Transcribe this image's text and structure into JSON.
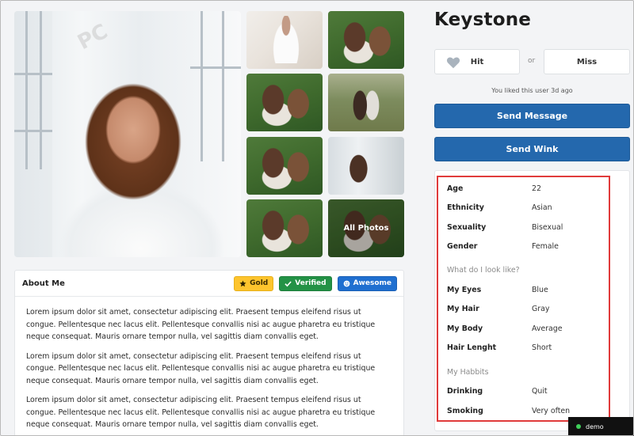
{
  "watermark": "PC",
  "gallery": {
    "all_photos_label": "All Photos"
  },
  "about": {
    "title": "About Me",
    "badges": {
      "gold": "Gold",
      "verified": "Verified",
      "awesome": "Awesome"
    },
    "paragraphs": [
      "Lorem ipsum dolor sit amet, consectetur adipiscing elit. Praesent tempus eleifend risus ut congue. Pellentesque nec lacus elit. Pellentesque convallis nisi ac augue pharetra eu tristique neque consequat. Mauris ornare tempor nulla, vel sagittis diam convallis eget.",
      "Lorem ipsum dolor sit amet, consectetur adipiscing elit. Praesent tempus eleifend risus ut congue. Pellentesque nec lacus elit. Pellentesque convallis nisi ac augue pharetra eu tristique neque consequat. Mauris ornare tempor nulla, vel sagittis diam convallis eget.",
      "Lorem ipsum dolor sit amet, consectetur adipiscing elit. Praesent tempus eleifend risus ut congue. Pellentesque nec lacus elit. Pellentesque convallis nisi ac augue pharetra eu tristique neque consequat. Mauris ornare tempor nulla, vel sagittis diam convallis eget."
    ]
  },
  "profile": {
    "name": "Keystone",
    "hit_label": "Hit",
    "or_label": "or",
    "miss_label": "Miss",
    "liked_text": "You liked this user 3d ago",
    "send_message_label": "Send Message",
    "send_wink_label": "Send Wink"
  },
  "details": {
    "basic": [
      {
        "key": "Age",
        "value": "22"
      },
      {
        "key": "Ethnicity",
        "value": "Asian"
      },
      {
        "key": "Sexuality",
        "value": "Bisexual"
      },
      {
        "key": "Gender",
        "value": "Female"
      }
    ],
    "look_heading": "What do I look like?",
    "look": [
      {
        "key": "My Eyes",
        "value": "Blue"
      },
      {
        "key": "My Hair",
        "value": "Gray"
      },
      {
        "key": "My Body",
        "value": "Average"
      },
      {
        "key": "Hair Lenght",
        "value": "Short"
      }
    ],
    "habits_heading": "My Habbits",
    "habits": [
      {
        "key": "Drinking",
        "value": "Quit"
      },
      {
        "key": "Smoking",
        "value": "Very often"
      }
    ]
  },
  "status": {
    "label": "demo",
    "dot_color": "#3fcf5a"
  },
  "colors": {
    "primary": "#2468ad",
    "gold": "#fec42d",
    "verified": "#239246",
    "awesome": "#1f6fd0",
    "highlight": "#e03b3b"
  }
}
